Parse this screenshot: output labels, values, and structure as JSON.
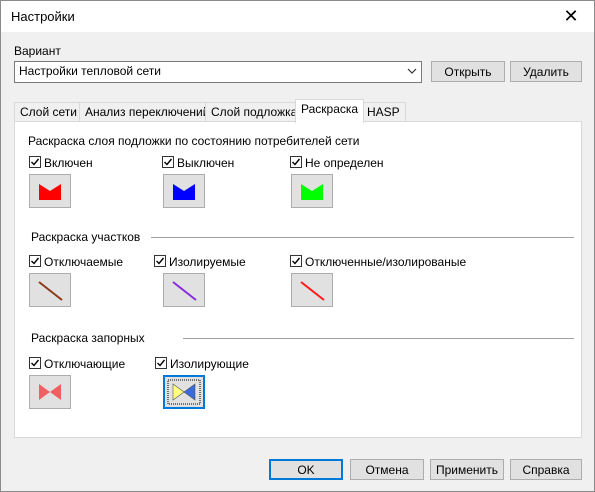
{
  "window": {
    "title": "Настройки"
  },
  "variant": {
    "label": "Вариант",
    "selected": "Настройки тепловой сети",
    "open_label": "Открыть",
    "delete_label": "Удалить"
  },
  "tabs": [
    {
      "label": "Слой сети"
    },
    {
      "label": "Анализ переключений"
    },
    {
      "label": "Слой подложка"
    },
    {
      "label": "Раскраска"
    },
    {
      "label": "HASP"
    }
  ],
  "consumers": {
    "title": "Раскраска слоя подложки по состоянию потребителей сети",
    "items": [
      {
        "label": "Включен",
        "checked": true,
        "color": "#ff0000"
      },
      {
        "label": "Выключен",
        "checked": true,
        "color": "#0000ff"
      },
      {
        "label": "Не определен",
        "checked": true,
        "color": "#00ff00"
      }
    ]
  },
  "sections": {
    "title": "Раскраска участков",
    "items": [
      {
        "label": "Отключаемые",
        "checked": true,
        "color": "#8b3a1a"
      },
      {
        "label": "Изолируемые",
        "checked": true,
        "color": "#8a2be2"
      },
      {
        "label": "Отключенные/изолированые",
        "checked": true,
        "color": "#ff1a1a"
      }
    ]
  },
  "valves": {
    "title": "Раскраска запорных",
    "items": [
      {
        "label": "Отключающие",
        "checked": true,
        "color_left": "#f06060",
        "color_right": "#f06060"
      },
      {
        "label": "Изолирующие",
        "checked": true,
        "color_left": "#ffff80",
        "color_right": "#3a6ae0"
      }
    ]
  },
  "footer": {
    "ok_label": "OK",
    "cancel_label": "Отмена",
    "apply_label": "Применить",
    "help_label": "Справка"
  }
}
